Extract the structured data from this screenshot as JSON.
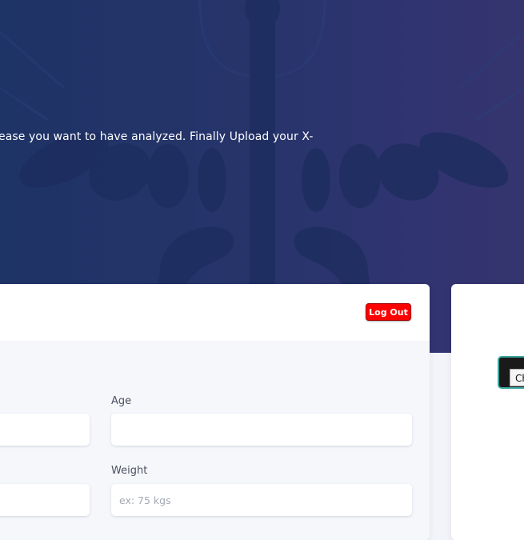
{
  "hero": {
    "text": "ease you want to have analyzed. Finally Upload your X-"
  },
  "header": {
    "logout_label": "Log Out"
  },
  "form": {
    "age": {
      "label": "Age",
      "value": "",
      "placeholder": ""
    },
    "weight": {
      "label": "Weight",
      "value": "",
      "placeholder": "ex: 75 kgs"
    },
    "left_top": {
      "value": "",
      "placeholder": ""
    },
    "left_bottom": {
      "value": "",
      "placeholder": ""
    }
  },
  "side_panel": {
    "tooltip_text": "Ch"
  },
  "colors": {
    "hero_start": "#1e3366",
    "hero_end": "#35346f",
    "logout_bg": "#ff0000",
    "button_border": "#3aa8a0"
  },
  "icons": {
    "background_art": "caduceus-emblem"
  }
}
